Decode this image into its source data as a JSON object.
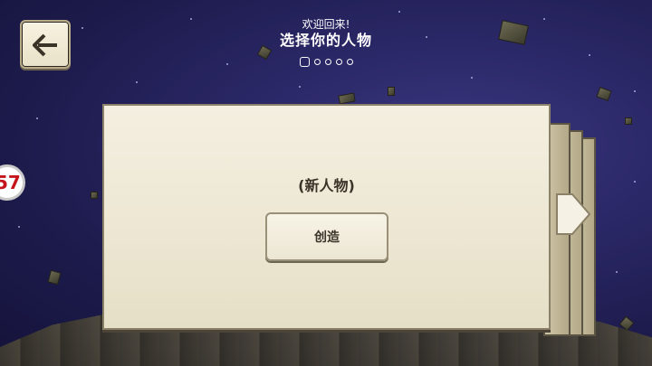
{
  "header": {
    "subtitle": "欢迎回来!",
    "title": "选择你的人物",
    "page_dots": 5,
    "active_dot": 1
  },
  "card": {
    "label": "(新人物)",
    "create_button": "创造"
  },
  "side_icon": {
    "text": "57"
  },
  "icons": {
    "back": "back-arrow-icon",
    "next": "next-arrow-icon"
  },
  "colors": {
    "card_bg": "#f4efe0",
    "card_text": "#3a3328",
    "sky": "#2a2766"
  }
}
